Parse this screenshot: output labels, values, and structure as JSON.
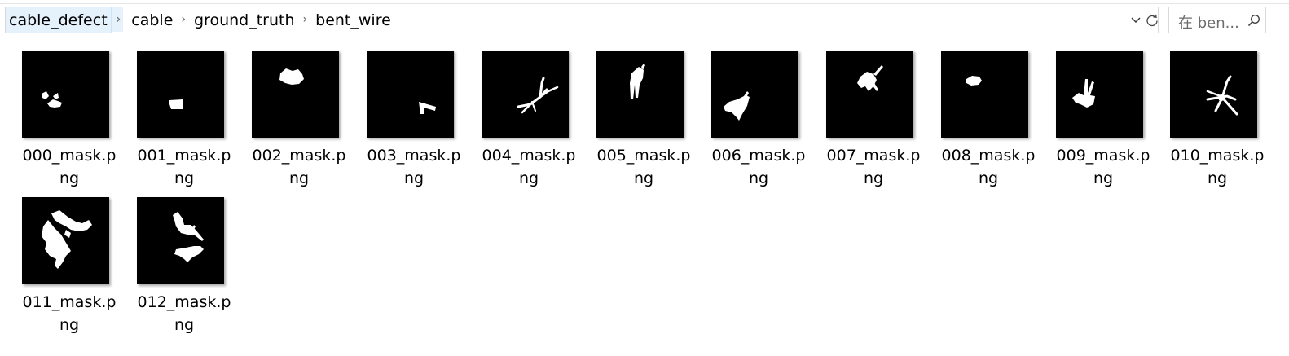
{
  "address_bar": {
    "breadcrumbs": [
      "cable_defect",
      "cable",
      "ground_truth",
      "bent_wire"
    ]
  },
  "search": {
    "placeholder": "在 ben..."
  },
  "icons": {
    "separator": "chevron-right-icon",
    "dropdown": "chevron-down-icon",
    "refresh": "refresh-icon",
    "search": "search-icon"
  },
  "files": [
    {
      "name_line1": "000_mask.p",
      "name_line2": "ng"
    },
    {
      "name_line1": "001_mask.p",
      "name_line2": "ng"
    },
    {
      "name_line1": "002_mask.p",
      "name_line2": "ng"
    },
    {
      "name_line1": "003_mask.p",
      "name_line2": "ng"
    },
    {
      "name_line1": "004_mask.p",
      "name_line2": "ng"
    },
    {
      "name_line1": "005_mask.p",
      "name_line2": "ng"
    },
    {
      "name_line1": "006_mask.p",
      "name_line2": "ng"
    },
    {
      "name_line1": "007_mask.p",
      "name_line2": "ng"
    },
    {
      "name_line1": "008_mask.p",
      "name_line2": "ng"
    },
    {
      "name_line1": "009_mask.p",
      "name_line2": "ng"
    },
    {
      "name_line1": "010_mask.p",
      "name_line2": "ng"
    },
    {
      "name_line1": "011_mask.p",
      "name_line2": "ng"
    },
    {
      "name_line1": "012_mask.p",
      "name_line2": "ng"
    }
  ]
}
